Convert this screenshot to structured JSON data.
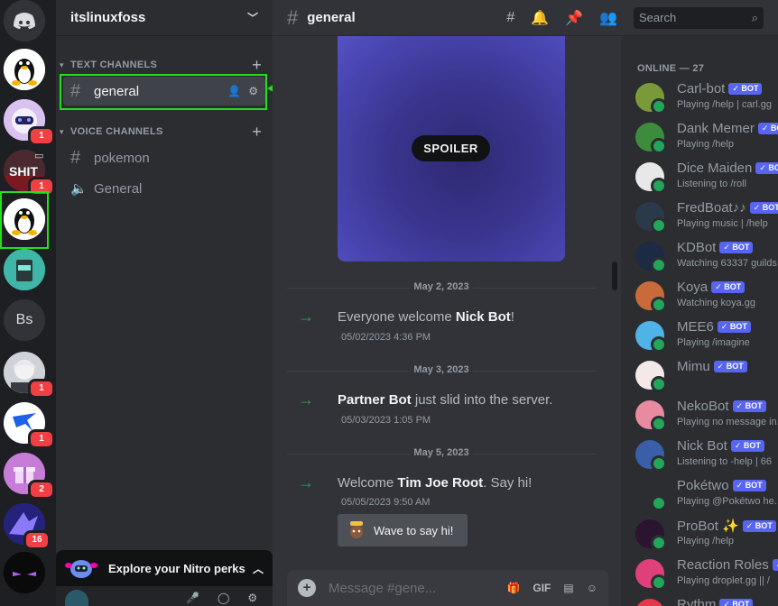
{
  "guild": {
    "name": "itslinuxfoss"
  },
  "servers": [
    {
      "badge": ""
    },
    {
      "badge": "1"
    },
    {
      "badge": "1",
      "label": "SHIT"
    },
    {
      "badge": ""
    },
    {
      "badge": ""
    },
    {
      "badge": "",
      "label": "Bs"
    },
    {
      "badge": "1"
    },
    {
      "badge": "1"
    },
    {
      "badge": "2"
    },
    {
      "badge": "16"
    },
    {
      "badge": ""
    }
  ],
  "categories": {
    "text": "TEXT CHANNELS",
    "voice": "VOICE CHANNELS"
  },
  "channels": {
    "general": "general",
    "pokemon": "pokemon",
    "voice_general": "General"
  },
  "nitro": {
    "label": "Explore your Nitro perks"
  },
  "topbar": {
    "channel": "general",
    "search_placeholder": "Search"
  },
  "spoiler": {
    "label": "SPOILER"
  },
  "messages": [
    {
      "date": "May 2, 2023",
      "pre": "Everyone welcome ",
      "user": "Nick Bot",
      "post": "!",
      "time": "05/02/2023 4:36 PM"
    },
    {
      "date": "May 3, 2023",
      "pre": "",
      "user": "Partner Bot",
      "post": " just slid into the server.",
      "time": "05/03/2023 1:05 PM"
    },
    {
      "date": "May 5, 2023",
      "pre": "Welcome ",
      "user": "Tim Joe Root",
      "post": ". Say hi!",
      "time": "05/05/2023 9:50 AM"
    }
  ],
  "wave": {
    "label": "Wave to say hi!"
  },
  "composer": {
    "placeholder": "Message #gene...",
    "gif": "GIF"
  },
  "members": {
    "header": "ONLINE — 27",
    "bot_tag": "BOT",
    "list": [
      {
        "name": "Carl-bot",
        "status": "Playing /help | carl.gg",
        "color": "#7a9a3a"
      },
      {
        "name": "Dank Memer",
        "status": "Playing /help",
        "color": "#3d8b3d"
      },
      {
        "name": "Dice Maiden",
        "status": "Listening to /roll",
        "color": "#e8e8e8"
      },
      {
        "name": "FredBoat♪♪",
        "status": "Playing music | /help",
        "color": "#2b3a4a"
      },
      {
        "name": "KDBot",
        "status": "Watching 63337 guilds",
        "color": "#1c2a44"
      },
      {
        "name": "Koya",
        "status": "Watching koya.gg",
        "color": "#c96a3a"
      },
      {
        "name": "MEE6",
        "status": "Playing /imagine",
        "color": "#4fb3e8"
      },
      {
        "name": "Mimu",
        "status": "",
        "color": "#f4e8e8"
      },
      {
        "name": "NekoBot",
        "status": "Playing no message in...",
        "color": "#e88aa0"
      },
      {
        "name": "Nick Bot",
        "status": "Listening to -help | 66",
        "color": "#3a5ea8"
      },
      {
        "name": "Pokétwo",
        "status": "Playing @Pokétwo he...",
        "color": "#2b2d31"
      },
      {
        "name": "ProBot ✨",
        "status": "Playing /help",
        "color": "#2a1430"
      },
      {
        "name": "Reaction Roles",
        "status": "Playing droplet.gg || /",
        "color": "#e0407a"
      },
      {
        "name": "Rythm",
        "status": "",
        "color": "#e8374a"
      }
    ]
  }
}
